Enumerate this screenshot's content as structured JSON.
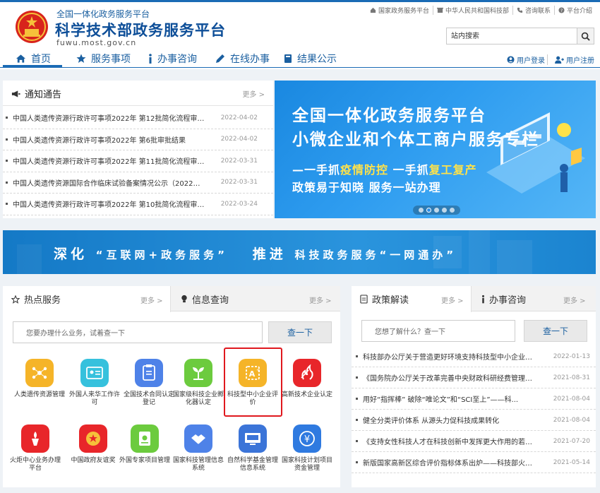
{
  "header": {
    "brand_sub": "全国一体化政务服务平台",
    "brand_title": "科学技术部政务服务平台",
    "brand_url": "fuwu.most.gov.cn",
    "top_links": [
      "国家政务服务平台",
      "中华人民共和国科技部",
      "咨询联系",
      "平台介绍"
    ],
    "search_placeholder": "站内搜索",
    "login": "用户登录",
    "register": "用户注册"
  },
  "nav": {
    "items": [
      "首页",
      "服务事项",
      "办事咨询",
      "在线办事",
      "结果公示"
    ],
    "active": "首页"
  },
  "notice": {
    "title": "通知通告",
    "more": "更多 >",
    "items": [
      {
        "text": "中国人类遗传资源行政许可事项2022年 第12批简化流程审批...",
        "date": "2022-04-02"
      },
      {
        "text": "中国人类遗传资源行政许可事项2022年 第6批审批结果",
        "date": "2022-04-02"
      },
      {
        "text": "中国人类遗传资源行政许可事项2022年 第11批简化流程审批...",
        "date": "2022-03-31"
      },
      {
        "text": "中国人类遗传资源国际合作临床试验备案情况公示（2022年3...",
        "date": "2022-03-31"
      },
      {
        "text": "中国人类遗传资源行政许可事项2022年 第10批简化流程审批...",
        "date": "2022-03-24"
      }
    ]
  },
  "carousel": {
    "line1": "全国一体化政务服务平台",
    "line2": "小微企业和个体工商户服务专栏",
    "line3_a": "一手抓",
    "line3_b": "疫情防控",
    "line3_c": " 一手抓",
    "line3_d": "复工复产",
    "line4": "政策易于知晓 服务一站办理",
    "slides": 5,
    "active_slide": 2
  },
  "banner": {
    "part1": "深化",
    "part2": "“互联网+政务服务”",
    "part3": "推进",
    "part4": "科技政务服务“一网通办”"
  },
  "hot": {
    "tab_hot": "热点服务",
    "tab_info": "信息查询",
    "more": "更多 >",
    "query_placeholder": "您要办理什么业务，试着查一下",
    "query_btn": "查一下",
    "services": [
      {
        "label": "人类遗传资源管理",
        "color": "#f5b428",
        "icon": "network-icon"
      },
      {
        "label": "外国人来华工作许可",
        "color": "#36c1dd",
        "icon": "id-card-icon"
      },
      {
        "label": "全国技术合同认定登记",
        "color": "#4e82e8",
        "icon": "contract-icon"
      },
      {
        "label": "国家级科技企业孵化器认定",
        "color": "#6ccb3e",
        "icon": "sprout-icon"
      },
      {
        "label": "科技型中小企业评价",
        "color": "#f5b428",
        "icon": "a-plus-icon"
      },
      {
        "label": "高新技术企业认定",
        "color": "#e8262a",
        "icon": "flame-icon"
      },
      {
        "label": "火炬中心业务办理平台",
        "color": "#e8262a",
        "icon": "torch-icon"
      },
      {
        "label": "中国政府友谊奖",
        "color": "#e8262a",
        "icon": "medal-icon"
      },
      {
        "label": "外国专家项目管理",
        "color": "#6ccb3e",
        "icon": "document-icon"
      },
      {
        "label": "国家科技管理信息系统",
        "color": "#4e82e8",
        "icon": "handshake-icon"
      },
      {
        "label": "自然科学基金管理信息系统",
        "color": "#3b74d8",
        "icon": "nsfc-icon"
      },
      {
        "label": "国家科技计划项目资金管理",
        "color": "#2f7ae0",
        "icon": "yuan-icon"
      }
    ]
  },
  "policy": {
    "tab_policy": "政策解读",
    "tab_consult": "办事咨询",
    "more": "更多 >",
    "query_placeholder": "您想了解什么？查一下",
    "query_btn": "查一下",
    "items": [
      {
        "text": "科技部办公厅关于营造更好环境支持科技型中小企业研...",
        "date": "2022-01-13"
      },
      {
        "text": "《国务院办公厅关于改革完善中央财政科研经费管理的...",
        "date": "2021-08-31"
      },
      {
        "text": "用好“指挥棒” 破除“唯论文”和“SCI至上”——科...",
        "date": "2021-08-04"
      },
      {
        "text": "健全分类评价体系 从源头力促科技成果转化",
        "date": "2021-08-04"
      },
      {
        "text": "《支持女性科技人才在科技创新中发挥更大作用的若干...",
        "date": "2021-07-20"
      },
      {
        "text": "新版国家高新区综合评价指标体系出炉——科技部火炬...",
        "date": "2021-05-14"
      }
    ]
  },
  "colors": {
    "primary": "#1a6bb5",
    "highlight": "#e0181e"
  }
}
